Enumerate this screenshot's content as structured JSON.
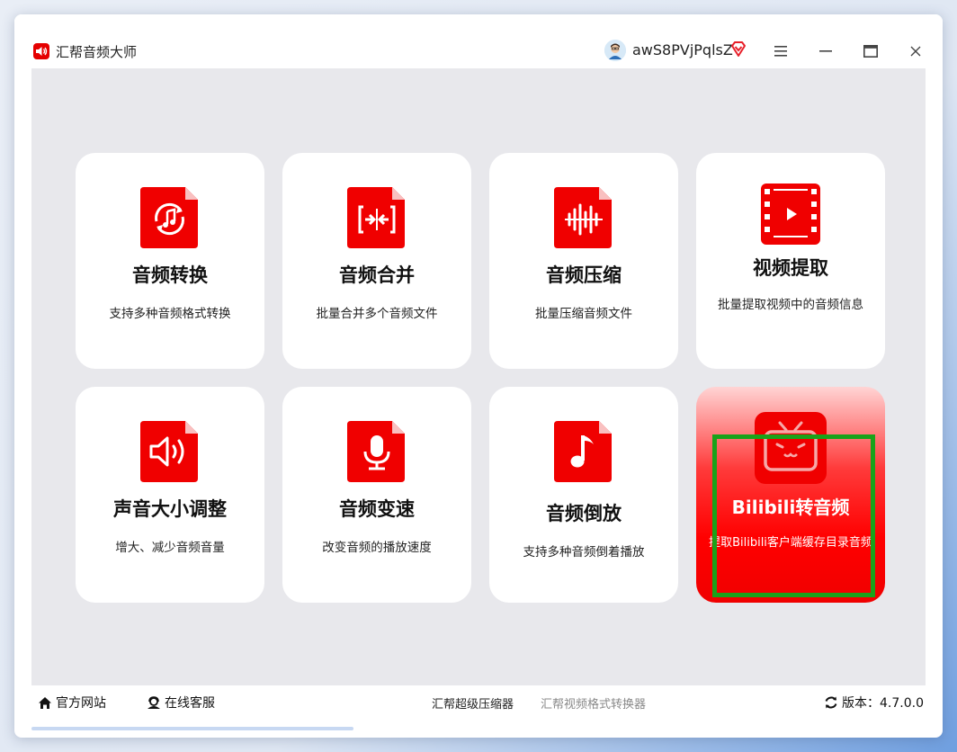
{
  "window": {
    "title": "汇帮音频大师",
    "username": "awS8PVjPqlsZ"
  },
  "cards": [
    {
      "title": "音频转换",
      "desc": "支持多种音频格式转换",
      "icon": "audio-convert-icon"
    },
    {
      "title": "音频合并",
      "desc": "批量合并多个音频文件",
      "icon": "audio-merge-icon"
    },
    {
      "title": "音频压缩",
      "desc": "批量压缩音频文件",
      "icon": "audio-compress-icon"
    },
    {
      "title": "视频提取",
      "desc": "批量提取视频中的音频信息",
      "icon": "video-extract-icon"
    },
    {
      "title": "声音大小调整",
      "desc": "增大、减少音频音量",
      "icon": "volume-adjust-icon"
    },
    {
      "title": "音频变速",
      "desc": "改变音频的播放速度",
      "icon": "microphone-icon"
    },
    {
      "title": "音频倒放",
      "desc": "支持多种音频倒着播放",
      "icon": "music-note-icon"
    },
    {
      "title": "Bilibili转音频",
      "desc": "提取Bilibili客户端缓存目录音频",
      "icon": "bilibili-tv-icon"
    }
  ],
  "bottom": {
    "website": "官方网站",
    "support": "在线客服",
    "link1": "汇帮超级压缩器",
    "link2": "汇帮视频格式转换器",
    "version": "版本：4.7.0.0"
  },
  "colors": {
    "accent": "#ff0000",
    "content_bg": "#e8e8ec",
    "highlight": "#1aa21a"
  }
}
